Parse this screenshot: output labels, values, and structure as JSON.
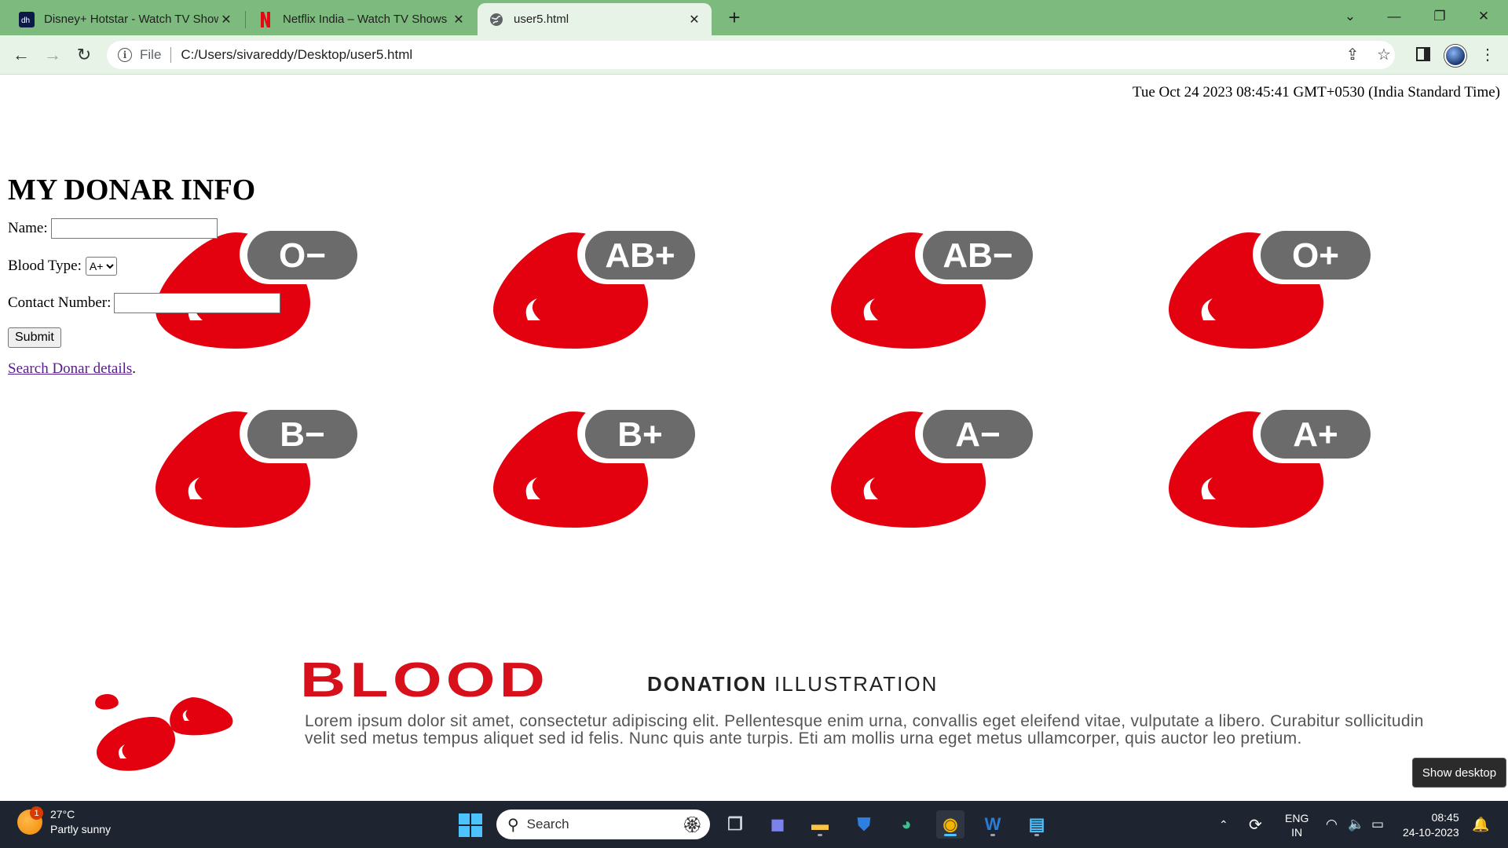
{
  "browser": {
    "tabs": [
      {
        "title": "Disney+ Hotstar - Watch TV Shows",
        "favicon": "hotstar-icon"
      },
      {
        "title": "Netflix India – Watch TV Shows Online",
        "favicon": "netflix-icon"
      },
      {
        "title": "user5.html",
        "favicon": "globe-icon"
      }
    ],
    "address": {
      "scheme": "File",
      "url": "C:/Users/sivareddy/Desktop/user5.html"
    }
  },
  "page": {
    "datetime": "Tue Oct 24 2023 08:45:41 GMT+0530 (India Standard Time)",
    "heading": "MY DONAR INFO",
    "form": {
      "name_label": "Name:",
      "name_value": "",
      "blood_label": "Blood Type:",
      "blood_selected": "A+",
      "contact_label": "Contact Number:",
      "contact_value": "",
      "submit_label": "Submit",
      "search_link": "Search Donar details",
      "search_suffix": "."
    },
    "blood_groups": [
      "O−",
      "AB+",
      "AB−",
      "O+",
      "B−",
      "B+",
      "A−",
      "A+"
    ],
    "banner": {
      "title": "BLOOD",
      "subtitle_bold": "DONATION",
      "subtitle_rest": "ILLUSTRATION",
      "lorem": "Lorem ipsum dolor sit amet, consectetur adipiscing elit. Pellentesque enim urna, convallis eget eleifend vitae, vulputate a libero. Curabitur sollicitudin velit sed metus tempus aliquet sed id felis. Nunc quis ante turpis. Eti am mollis urna eget metus ullamcorper, quis auctor leo pretium."
    },
    "tooltip": "Show desktop",
    "colors": {
      "drop_red": "#e3000f",
      "badge_gray": "#6b6b6b",
      "tab_green": "#7dba7d"
    }
  },
  "taskbar": {
    "weather": {
      "temp": "27°C",
      "desc": "Partly sunny",
      "badge": "1"
    },
    "search_placeholder": "Search",
    "lang": {
      "line1": "ENG",
      "line2": "IN"
    },
    "clock": {
      "time": "08:45",
      "date": "24-10-2023"
    }
  }
}
